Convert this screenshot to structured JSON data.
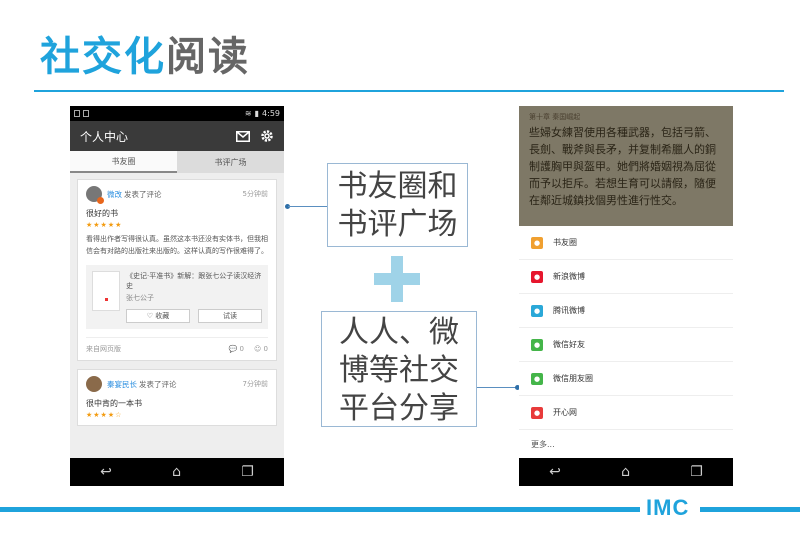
{
  "slide": {
    "title_part1": "社交化",
    "title_part2": "阅读",
    "logo": "IMC",
    "accent_color": "#1fa3dc"
  },
  "callouts": {
    "first_line1": "书友圈和",
    "first_line2": "书评广场",
    "second_line1": "人人、微",
    "second_line2": "博等社交",
    "second_line3": "平台分享"
  },
  "left_phone": {
    "status_time": "4:59",
    "app_title": "个人中心",
    "tabs": [
      "书友圈",
      "书评广场"
    ],
    "cards": [
      {
        "user": "微改",
        "action": "发表了评论",
        "time": "5分钟前",
        "title": "很好的书",
        "stars": "★★★★★",
        "body": "看得出作者写得很认真。虽然这本书还没有实体书，但我相信会有对路的出版社来出版的。这样认真的写作很难得了。",
        "book_title": "《史记·平准书》新解：跟张七公子读汉经济史",
        "book_author": "张七公子",
        "collect_label": "♡ 收藏",
        "read_label": "试读",
        "source": "来自网页版",
        "comments": "0",
        "likes": "0"
      },
      {
        "user": "秦宴民长",
        "action": "发表了评论",
        "time": "7分钟前",
        "title": "很中肯的一本书",
        "stars": "★★★★☆"
      }
    ]
  },
  "right_phone": {
    "chapter": "第十章 秦国崛起",
    "reader_text": "些婦女練習使用各種武器，包括弓箭、長劍、戰斧與長矛，并复制希臘人的銅制護胸甲與盔甲。她們將婚姻視為屈從而予以拒斥。若想生育可以請假，隨便在鄰近城鎮找個男性進行性交。",
    "share_items": [
      {
        "label": "书友圈",
        "color": "#f0a030",
        "icon": "users-icon"
      },
      {
        "label": "新浪微博",
        "color": "#e6162d",
        "icon": "weibo-icon"
      },
      {
        "label": "腾讯微博",
        "color": "#2aa8d8",
        "icon": "tencent-weibo-icon"
      },
      {
        "label": "微信好友",
        "color": "#44b549",
        "icon": "wechat-icon"
      },
      {
        "label": "微信朋友圈",
        "color": "#44b549",
        "icon": "moments-icon"
      },
      {
        "label": "开心网",
        "color": "#e83a3a",
        "icon": "kaixin-icon"
      }
    ],
    "more_label": "更多..."
  }
}
